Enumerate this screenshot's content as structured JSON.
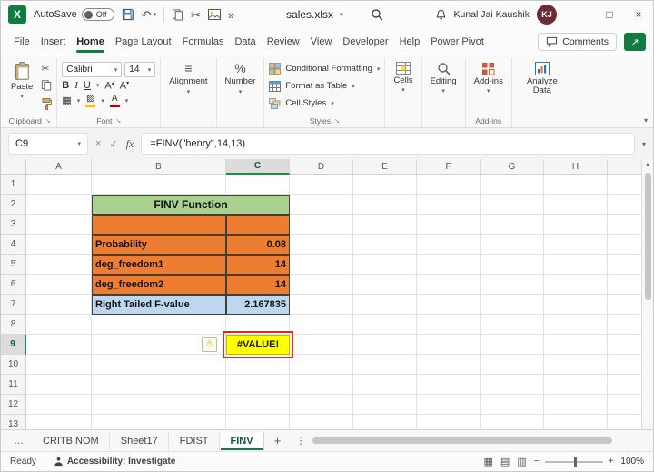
{
  "colors": {
    "excel_green": "#107C41",
    "table_title_green": "#A9D08E",
    "table_orange": "#ED7D31",
    "table_blue": "#BDD7EE",
    "error_fill_yellow": "#FFFF00",
    "error_outline_red": "#E02B20"
  },
  "icons": {
    "logo": "X",
    "undo": "↶",
    "dropdown": "▾",
    "overflow": "»",
    "cut": "✂",
    "window_minimize": "─",
    "window_maximize": "□",
    "window_close": "×",
    "cancel": "×",
    "enter": "✓",
    "fx": "fx",
    "bold": "B",
    "italic": "I",
    "underline": "U",
    "grow_font": "A",
    "shrink_font": "A",
    "align": "≡",
    "percent": "%",
    "borders": "▦",
    "fill": "▨",
    "font_color": "A",
    "share_arrow": "↗",
    "ellipsis_v": "⋮",
    "view_normal": "▦",
    "view_layout": "▤",
    "view_break": "▥",
    "zoom_out": "−",
    "zoom_in": "+",
    "scroll_up": "▲"
  },
  "titlebar": {
    "autosave_label": "AutoSave",
    "autosave_state": "Off",
    "filename": "sales.xlsx",
    "user_name": "Kunal Jai Kaushik",
    "user_initials": "KJ"
  },
  "menubar": {
    "tabs": [
      "File",
      "Insert",
      "Home",
      "Page Layout",
      "Formulas",
      "Data",
      "Review",
      "View",
      "Developer",
      "Help",
      "Power Pivot"
    ],
    "active_tab": "Home",
    "comments": "Comments"
  },
  "ribbon": {
    "paste": "Paste",
    "clipboard_group": "Clipboard",
    "font_name": "Calibri",
    "font_size": "14",
    "font_group": "Font",
    "alignment": "Alignment",
    "number": "Number",
    "conditional_formatting": "Conditional Formatting",
    "format_as_table": "Format as Table",
    "cell_styles": "Cell Styles",
    "styles_group": "Styles",
    "cells": "Cells",
    "editing": "Editing",
    "addins": "Add-ins",
    "addins_group": "Add-ins",
    "analyze_data": "Analyze Data"
  },
  "formula_bar": {
    "cell_reference": "C9",
    "formula": "=FINV(\"henry\",14,13)"
  },
  "grid": {
    "columns": [
      "A",
      "B",
      "C",
      "D",
      "E",
      "F",
      "G",
      "H"
    ],
    "rows": [
      1,
      2,
      3,
      4,
      5,
      6,
      7,
      8,
      9,
      10,
      11,
      12,
      13
    ],
    "selected_column": "C",
    "selected_row": 9,
    "merged_away": [
      "C2"
    ],
    "cells": {
      "B2": {
        "text": "FINV Function",
        "class": "title"
      },
      "B3": {
        "text": "",
        "class": "t-label"
      },
      "C3": {
        "text": "",
        "class": "t-value"
      },
      "B4": {
        "text": "Probability",
        "class": "t-label"
      },
      "C4": {
        "text": "0.08",
        "class": "t-value"
      },
      "B5": {
        "text": "deg_freedom1",
        "class": "t-label"
      },
      "C5": {
        "text": "14",
        "class": "t-value"
      },
      "B6": {
        "text": "deg_freedom2",
        "class": "t-label"
      },
      "C6": {
        "text": "14",
        "class": "t-value"
      },
      "B7": {
        "text": "Right Tailed F-value",
        "class": "t-label blue"
      },
      "C7": {
        "text": "2.167835",
        "class": "t-value blue"
      },
      "B9": {
        "text": "⚠",
        "class": "warn"
      },
      "C9": {
        "text": "#VALUE!",
        "class": "error"
      }
    }
  },
  "sheet_tabs": {
    "overflow": "…",
    "tabs": [
      "CRITBINOM",
      "Sheet17",
      "FDIST",
      "FINV"
    ],
    "active": "FINV",
    "add": "+"
  },
  "status_bar": {
    "mode": "Ready",
    "accessibility": "Accessibility: Investigate",
    "zoom": "100%"
  }
}
